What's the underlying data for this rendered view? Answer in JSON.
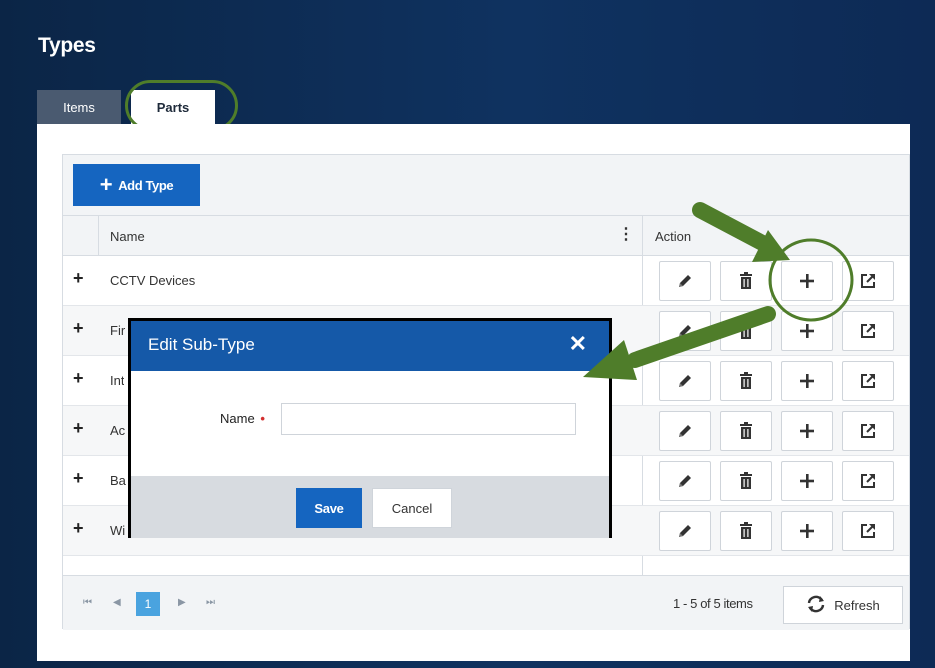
{
  "page": {
    "title": "Types"
  },
  "tabs": [
    {
      "label": "Items",
      "active": false
    },
    {
      "label": "Parts",
      "active": true
    }
  ],
  "toolbar": {
    "add_label": "Add Type"
  },
  "table": {
    "columns": {
      "name": "Name",
      "action": "Action"
    },
    "rows": [
      {
        "name": "CCTV Devices"
      },
      {
        "name": "Fir"
      },
      {
        "name": "Int"
      },
      {
        "name": "Ac"
      },
      {
        "name": "Ba"
      },
      {
        "name": "Wi"
      }
    ]
  },
  "pager": {
    "current_page": "1",
    "info": "1 - 5 of 5 items",
    "refresh_label": "Refresh"
  },
  "dialog": {
    "title": "Edit Sub-Type",
    "close_glyph": "✕",
    "name_label": "Name",
    "required_mark": "•",
    "name_value": "",
    "save_label": "Save",
    "cancel_label": "Cancel"
  },
  "colors": {
    "primary_blue": "#1565c0",
    "dialog_header": "#1559a8",
    "annotation_green": "#4f7d2a",
    "background_navy": "#0f3260"
  }
}
